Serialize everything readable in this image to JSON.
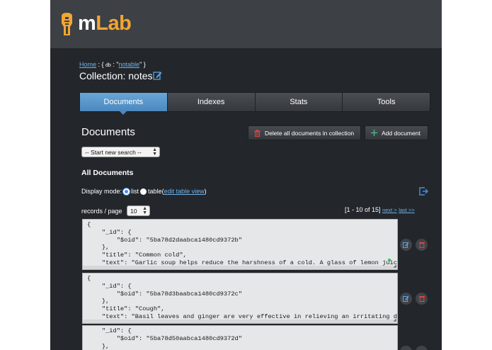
{
  "brand": {
    "logo_text": "mLab",
    "logo_m": "m",
    "logo_rest": "Lab"
  },
  "breadcrumb": {
    "home": "Home",
    "sep1": " : { ",
    "db_key": "db",
    "sep2": " : \"",
    "db_name": "notable",
    "end": "\" }"
  },
  "collection": {
    "label": "Collection: notes"
  },
  "tabs": [
    {
      "label": "Documents",
      "active": true
    },
    {
      "label": "Indexes",
      "active": false
    },
    {
      "label": "Stats",
      "active": false
    },
    {
      "label": "Tools",
      "active": false
    }
  ],
  "documents_heading": "Documents",
  "buttons": {
    "delete_all": "Delete all documents in collection",
    "add_document": "Add document"
  },
  "search": {
    "selected": "-- Start new search --"
  },
  "all_documents_heading": "All Documents",
  "display_mode": {
    "label": "Display mode:",
    "list": "list",
    "table": "table",
    "open_paren": " (",
    "edit_table_view": "edit table view",
    "close_paren": ")",
    "selected": "list"
  },
  "records": {
    "label": "records / page",
    "value": "10"
  },
  "pagination": {
    "range": "[1 - 10 of 15]",
    "next": "next >",
    "last": "last >>"
  },
  "documents": [
    {
      "text": "{\n    \"_id\": {\n        \"$oid\": \"5ba78d2daabca1480cd9372b\"\n    },\n    \"title\": \"Common cold\",\n    \"text\": \"Garlic soup helps reduce the harshness of a cold. A glass of lemon juice a day would raise\nthe bodys resistance. Onion juice can also help avoid a cold. Drink plenty of water, at least 6-8"
    },
    {
      "text": "{\n    \"_id\": {\n        \"$oid\": \"5ba78d3baabca1480cd9372c\"\n    },\n    \"title\": \"Cough\",\n    \"text\": \"Basil leaves and ginger are very effective in relieving an irritating dry cough. You can either\nchew basil leaves or take fresh ginger with hot water. Eat grapes. Grapes when eaten regularly can"
    },
    {
      "text": "    \"_id\": {\n        \"$oid\": \"5ba78d50aabca1480cd9372d\"\n    },\n    \"title\": \"Fever\","
    }
  ],
  "colors": {
    "accent": "#4c88bd",
    "brand_orange": "#f1a634",
    "link": "#6fb1e7",
    "background": "#23272c",
    "header": "#3d4045",
    "delete_red": "#e0463c",
    "add_green": "#4fb783"
  },
  "icons": [
    "mlab-logo-icon",
    "pencil-icon",
    "trash-icon",
    "plus-icon",
    "export-icon"
  ]
}
